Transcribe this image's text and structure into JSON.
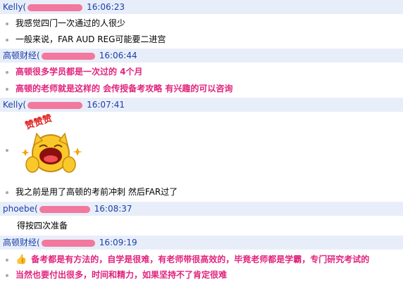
{
  "messages": [
    {
      "sender": "Kelly(",
      "time": "16:06:23"
    },
    {
      "text": "我感觉四门一次通过的人很少"
    },
    {
      "text": "一般来说，FAR AUD REG可能要二进宫"
    },
    {
      "sender": "高顿财经(",
      "time": "16:06:44"
    },
    {
      "text": "高顿很多学员都是一次过的   4个月"
    },
    {
      "text": "高顿的老师就是这样的  会传授备考攻略   有兴趣的可以咨询"
    },
    {
      "sender": "Kelly(",
      "time": "16:07:41"
    },
    {
      "sticker_text": "赞赞赞"
    },
    {
      "text": "我之前是用了高顿的考前冲刺 然后FAR过了"
    },
    {
      "sender": "phoebe(",
      "time": "16:08:37"
    },
    {
      "text": "得按四次准备"
    },
    {
      "sender": "高顿财经(",
      "time": "16:09:19"
    },
    {
      "text": "备考都是有方法的，自学是很难，有老师带很高效的，毕竟老师都是学霸，专门研究考试的"
    },
    {
      "text": "当然也要付出很多，时间和精力，如果坚持不了肯定很难"
    }
  ],
  "colors": {
    "name": "#1a3ea8",
    "highlight": "#e0247c",
    "mask": "#f2789e",
    "row_bg": "#e8eef9"
  },
  "icons": {
    "thumb": "👍"
  }
}
